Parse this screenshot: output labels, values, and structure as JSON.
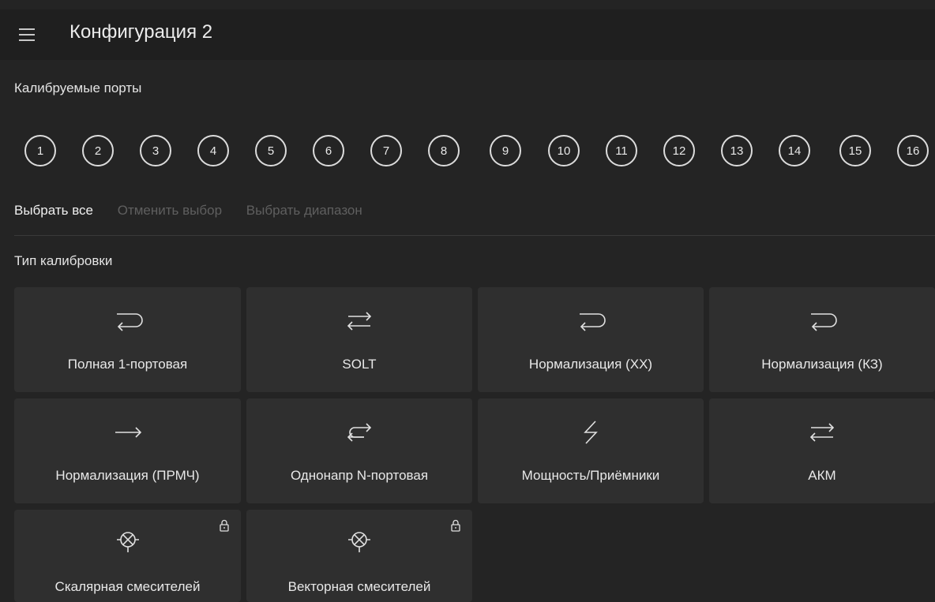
{
  "header": {
    "title": "Конфигурация 2"
  },
  "ports_section": {
    "label": "Калибруемые порты",
    "ports": [
      "1",
      "2",
      "3",
      "4",
      "5",
      "6",
      "7",
      "8",
      "9",
      "10",
      "11",
      "12",
      "13",
      "14",
      "15",
      "16"
    ]
  },
  "actions": {
    "select_all": "Выбрать все",
    "deselect": "Отменить выбор",
    "select_range": "Выбрать диапазон"
  },
  "calibration_section": {
    "label": "Тип калибровки",
    "types": [
      {
        "label": "Полная 1-портовая",
        "icon": "return-arrow-icon",
        "locked": false
      },
      {
        "label": "SOLT",
        "icon": "bidirectional-arrows-icon",
        "locked": false
      },
      {
        "label": "Нормализация (XX)",
        "icon": "return-arrow-icon",
        "locked": false
      },
      {
        "label": "Нормализация (КЗ)",
        "icon": "return-arrow-icon",
        "locked": false
      },
      {
        "label": "Нормализация (ПРМЧ)",
        "icon": "right-arrow-icon",
        "locked": false
      },
      {
        "label": "Однонапр N-портовая",
        "icon": "one-way-arrows-icon",
        "locked": false
      },
      {
        "label": "Мощность/Приёмники",
        "icon": "lightning-icon",
        "locked": false
      },
      {
        "label": "АКМ",
        "icon": "bidirectional-arrows-icon",
        "locked": false
      },
      {
        "label": "Скалярная смесителей",
        "icon": "mixer-icon",
        "locked": true
      },
      {
        "label": "Векторная смесителей",
        "icon": "mixer-icon",
        "locked": true
      }
    ]
  }
}
